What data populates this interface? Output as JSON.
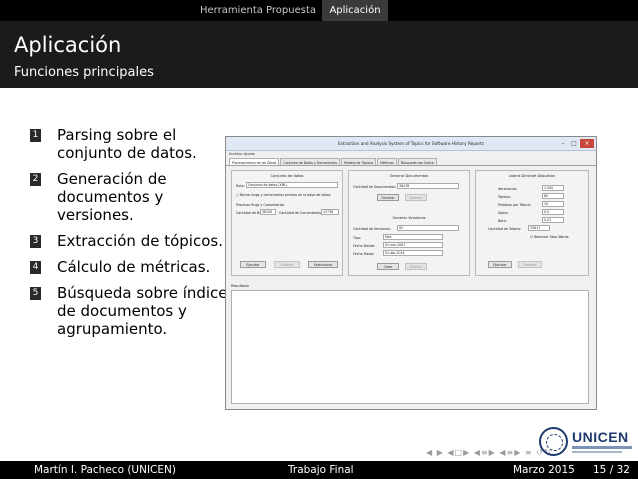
{
  "nav": {
    "tab_1": "Herramienta Propuesta",
    "tab_2": "Aplicación"
  },
  "header": {
    "title": "Aplicación",
    "subtitle": "Funciones principales"
  },
  "list": [
    {
      "num": "1",
      "text": "Parsing sobre el conjunto de datos."
    },
    {
      "num": "2",
      "text": "Generación de documentos y versiones."
    },
    {
      "num": "3",
      "text": "Extracción de tópicos."
    },
    {
      "num": "4",
      "text": "Cálculo de métricas."
    },
    {
      "num": "5",
      "text": "Búsqueda sobre índice de documentos y agrupamiento."
    }
  ],
  "app": {
    "window_title": "Extraction and Analysis System of Topics for Software History Reports",
    "menu": "Archivo  Ayuda",
    "tabs": [
      "Procesamiento de los Datos",
      "Conjunto de Datos y Documentos",
      "Modelo de Tópicos",
      "Métricas",
      "Búsqueda con Índice"
    ],
    "panel_1": {
      "title": "Conjunto de datos",
      "path_label": "Ruta:",
      "path_value": "Conjunto de datos (XML)",
      "check_label": "Borrar bugs y comentarios previos en la base de datos",
      "section": "Procesar Bugs y Comentarios",
      "bugs_label": "Cantidad de Bugs:",
      "bugs_value": "36109",
      "comments_label": "Cantidad de Comentarios:",
      "comments_value": "47738",
      "buttons": [
        "Ejecutar",
        "Detener",
        "Seleccionar"
      ]
    },
    "panel_2": {
      "title": "Generar Documentos",
      "docs_label": "Cantidad de Documentos:",
      "docs_value": "36478",
      "buttons": [
        "Generar",
        "Detener"
      ],
      "versions_title": "Generar Versiones",
      "versions_label": "Cantidad de Versiones:",
      "versions_value": "91",
      "type_label": "Tipo:",
      "type_value": "Mes",
      "start_label": "Fecha Desde:",
      "start_value": "01-nov-2007",
      "end_label": "Fecha Hasta:",
      "end_value": "01-abr-2014",
      "buttons_2": [
        "Crear",
        "Detener"
      ]
    },
    "panel_3": {
      "title": "Latent Dirichlet Allocation",
      "iter_label": "Iteraciones:",
      "iter_value": "1.000",
      "topics_label": "Tópicos:",
      "topics_value": "60",
      "words_label": "Palabras por Tópico:",
      "words_value": "10",
      "alpha_label": "Alpha:",
      "alpha_value": "0,5",
      "beta_label": "Beta:",
      "beta_value": "0,01",
      "tokens_label": "Cantidad de Tokens:",
      "tokens_value": "33817",
      "check_label": "Remover Stop Words",
      "buttons": [
        "Ejecutar",
        "Detener"
      ]
    },
    "results_label": "Resultado"
  },
  "footer": {
    "author": "Martín I. Pacheco  (UNICEN)",
    "work": "Trabajo Final",
    "date": "Marzo 2015",
    "page": "15 / 32"
  },
  "logo_text": "UNICEN"
}
